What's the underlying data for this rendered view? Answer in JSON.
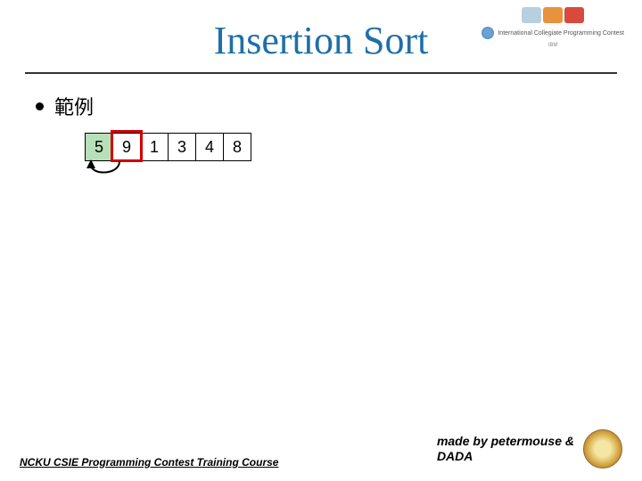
{
  "title": "Insertion Sort",
  "bullet_label": "範例",
  "cells": [
    "5",
    "9",
    "1",
    "3",
    "4",
    "8"
  ],
  "sorted_count": 1,
  "highlight_index": 1,
  "footer_left": "NCKU CSIE Programming Contest Training Course",
  "footer_credit_line1": "made by petermouse &",
  "footer_credit_line2": "DADA",
  "logo_colors": [
    "#B8CFE0",
    "#E8923C",
    "#D84B3C"
  ],
  "logo_text": "International Collegiate Programming Contest",
  "logo_sponsor": "IBM"
}
